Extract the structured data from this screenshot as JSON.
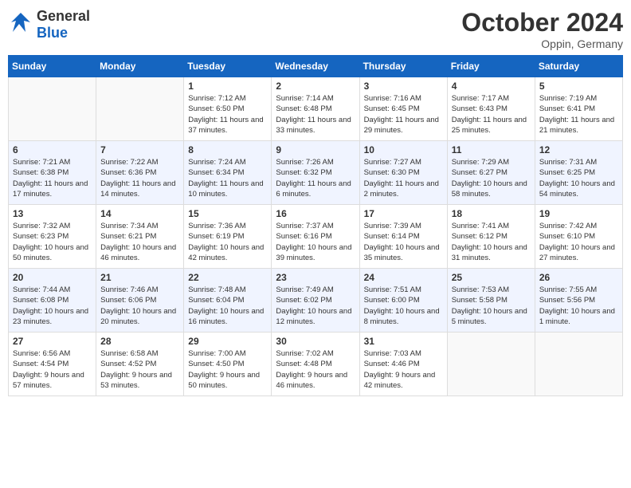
{
  "header": {
    "logo_general": "General",
    "logo_blue": "Blue",
    "title": "October 2024",
    "location": "Oppin, Germany"
  },
  "days_of_week": [
    "Sunday",
    "Monday",
    "Tuesday",
    "Wednesday",
    "Thursday",
    "Friday",
    "Saturday"
  ],
  "weeks": [
    [
      {
        "day": "",
        "info": ""
      },
      {
        "day": "",
        "info": ""
      },
      {
        "day": "1",
        "info": "Sunrise: 7:12 AM\nSunset: 6:50 PM\nDaylight: 11 hours\nand 37 minutes."
      },
      {
        "day": "2",
        "info": "Sunrise: 7:14 AM\nSunset: 6:48 PM\nDaylight: 11 hours\nand 33 minutes."
      },
      {
        "day": "3",
        "info": "Sunrise: 7:16 AM\nSunset: 6:45 PM\nDaylight: 11 hours\nand 29 minutes."
      },
      {
        "day": "4",
        "info": "Sunrise: 7:17 AM\nSunset: 6:43 PM\nDaylight: 11 hours\nand 25 minutes."
      },
      {
        "day": "5",
        "info": "Sunrise: 7:19 AM\nSunset: 6:41 PM\nDaylight: 11 hours\nand 21 minutes."
      }
    ],
    [
      {
        "day": "6",
        "info": "Sunrise: 7:21 AM\nSunset: 6:38 PM\nDaylight: 11 hours\nand 17 minutes."
      },
      {
        "day": "7",
        "info": "Sunrise: 7:22 AM\nSunset: 6:36 PM\nDaylight: 11 hours\nand 14 minutes."
      },
      {
        "day": "8",
        "info": "Sunrise: 7:24 AM\nSunset: 6:34 PM\nDaylight: 11 hours\nand 10 minutes."
      },
      {
        "day": "9",
        "info": "Sunrise: 7:26 AM\nSunset: 6:32 PM\nDaylight: 11 hours\nand 6 minutes."
      },
      {
        "day": "10",
        "info": "Sunrise: 7:27 AM\nSunset: 6:30 PM\nDaylight: 11 hours\nand 2 minutes."
      },
      {
        "day": "11",
        "info": "Sunrise: 7:29 AM\nSunset: 6:27 PM\nDaylight: 10 hours\nand 58 minutes."
      },
      {
        "day": "12",
        "info": "Sunrise: 7:31 AM\nSunset: 6:25 PM\nDaylight: 10 hours\nand 54 minutes."
      }
    ],
    [
      {
        "day": "13",
        "info": "Sunrise: 7:32 AM\nSunset: 6:23 PM\nDaylight: 10 hours\nand 50 minutes."
      },
      {
        "day": "14",
        "info": "Sunrise: 7:34 AM\nSunset: 6:21 PM\nDaylight: 10 hours\nand 46 minutes."
      },
      {
        "day": "15",
        "info": "Sunrise: 7:36 AM\nSunset: 6:19 PM\nDaylight: 10 hours\nand 42 minutes."
      },
      {
        "day": "16",
        "info": "Sunrise: 7:37 AM\nSunset: 6:16 PM\nDaylight: 10 hours\nand 39 minutes."
      },
      {
        "day": "17",
        "info": "Sunrise: 7:39 AM\nSunset: 6:14 PM\nDaylight: 10 hours\nand 35 minutes."
      },
      {
        "day": "18",
        "info": "Sunrise: 7:41 AM\nSunset: 6:12 PM\nDaylight: 10 hours\nand 31 minutes."
      },
      {
        "day": "19",
        "info": "Sunrise: 7:42 AM\nSunset: 6:10 PM\nDaylight: 10 hours\nand 27 minutes."
      }
    ],
    [
      {
        "day": "20",
        "info": "Sunrise: 7:44 AM\nSunset: 6:08 PM\nDaylight: 10 hours\nand 23 minutes."
      },
      {
        "day": "21",
        "info": "Sunrise: 7:46 AM\nSunset: 6:06 PM\nDaylight: 10 hours\nand 20 minutes."
      },
      {
        "day": "22",
        "info": "Sunrise: 7:48 AM\nSunset: 6:04 PM\nDaylight: 10 hours\nand 16 minutes."
      },
      {
        "day": "23",
        "info": "Sunrise: 7:49 AM\nSunset: 6:02 PM\nDaylight: 10 hours\nand 12 minutes."
      },
      {
        "day": "24",
        "info": "Sunrise: 7:51 AM\nSunset: 6:00 PM\nDaylight: 10 hours\nand 8 minutes."
      },
      {
        "day": "25",
        "info": "Sunrise: 7:53 AM\nSunset: 5:58 PM\nDaylight: 10 hours\nand 5 minutes."
      },
      {
        "day": "26",
        "info": "Sunrise: 7:55 AM\nSunset: 5:56 PM\nDaylight: 10 hours\nand 1 minute."
      }
    ],
    [
      {
        "day": "27",
        "info": "Sunrise: 6:56 AM\nSunset: 4:54 PM\nDaylight: 9 hours\nand 57 minutes."
      },
      {
        "day": "28",
        "info": "Sunrise: 6:58 AM\nSunset: 4:52 PM\nDaylight: 9 hours\nand 53 minutes."
      },
      {
        "day": "29",
        "info": "Sunrise: 7:00 AM\nSunset: 4:50 PM\nDaylight: 9 hours\nand 50 minutes."
      },
      {
        "day": "30",
        "info": "Sunrise: 7:02 AM\nSunset: 4:48 PM\nDaylight: 9 hours\nand 46 minutes."
      },
      {
        "day": "31",
        "info": "Sunrise: 7:03 AM\nSunset: 4:46 PM\nDaylight: 9 hours\nand 42 minutes."
      },
      {
        "day": "",
        "info": ""
      },
      {
        "day": "",
        "info": ""
      }
    ]
  ]
}
